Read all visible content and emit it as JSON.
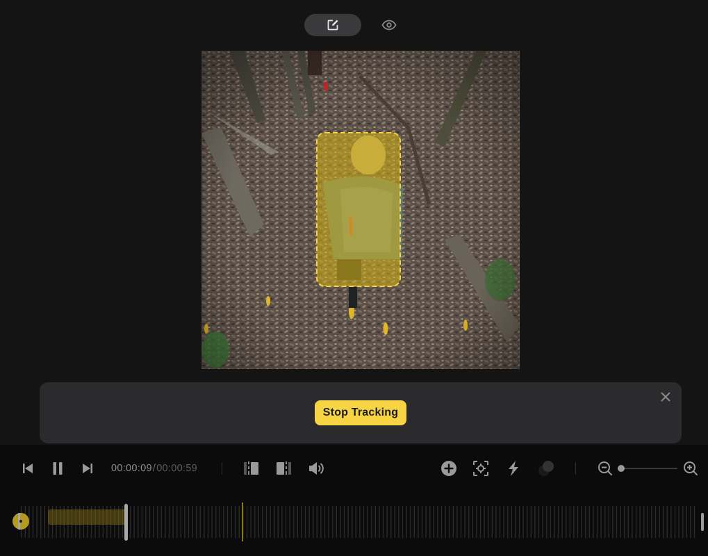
{
  "header": {
    "modes": [
      {
        "name": "edit",
        "icon": "edit-icon",
        "active": true
      },
      {
        "name": "preview",
        "icon": "eye-icon",
        "active": false
      }
    ]
  },
  "video": {
    "tracking_box": {
      "color": "#f7d444",
      "style": "dashed",
      "fill": "semi-transparent yellow"
    }
  },
  "tracking_panel": {
    "stop_label": "Stop Tracking",
    "close_icon": "close-icon"
  },
  "transport": {
    "prev_icon": "skip-back-icon",
    "pause_icon": "pause-icon",
    "next_icon": "skip-forward-icon",
    "current_time": "00:00:09",
    "separator": "/",
    "total_time": "00:00:59",
    "trim_start_icon": "trim-start-icon",
    "trim_end_icon": "trim-end-icon",
    "volume_icon": "volume-icon",
    "add_icon": "add-circle-icon",
    "track_icon": "focus-track-icon",
    "effect_icon": "lightning-icon",
    "color_icon": "color-circles-icon",
    "zoom_out_icon": "zoom-out-icon",
    "zoom_in_icon": "zoom-in-icon",
    "zoom_level": 0.0
  },
  "timeline": {
    "playhead_fraction": 0.155,
    "tracked_segment": {
      "start_fraction": 0.04,
      "end_fraction": 0.155
    },
    "keyframe_fraction": 0.327,
    "accent": "#f7d444"
  }
}
